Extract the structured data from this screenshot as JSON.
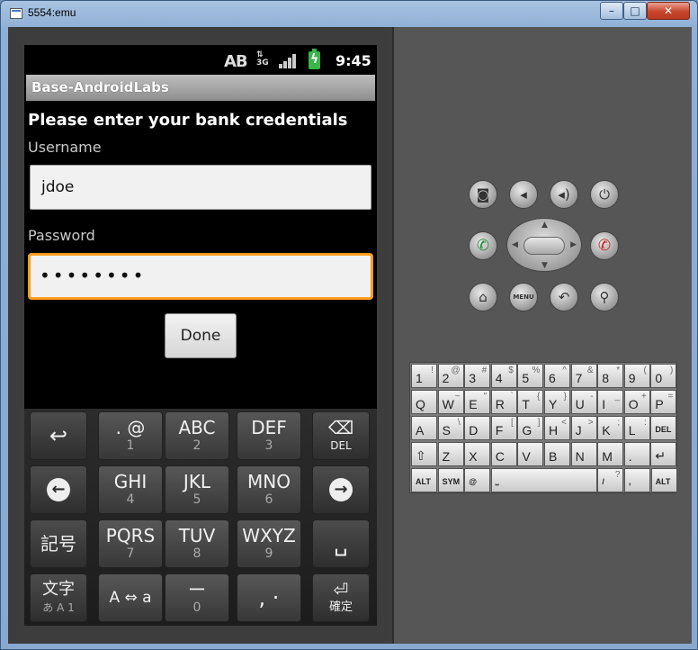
{
  "window": {
    "title": "5554:emu",
    "buttons": {
      "minimize": "–",
      "maximize": "□",
      "close": "✕"
    }
  },
  "statusbar": {
    "input_indicator": "AB",
    "network": "3G",
    "time": "9:45"
  },
  "app": {
    "title": "Base-AndroidLabs",
    "heading": "Please enter your bank credentials",
    "username_label": "Username",
    "username_value": "jdoe",
    "password_label": "Password",
    "password_value": "••••••••",
    "done_label": "Done"
  },
  "soft_keyboard": {
    "row1": [
      {
        "main": "↩",
        "sub": "",
        "icon": "undo-icon"
      },
      {
        "main": ". @",
        "sub": "1"
      },
      {
        "main": "ABC",
        "sub": "2"
      },
      {
        "main": "DEF",
        "sub": "3"
      },
      {
        "main": "⌫",
        "sub": "DEL",
        "icon": "backspace-icon"
      }
    ],
    "row2": [
      {
        "main": "←",
        "icon": "left-arrow-icon"
      },
      {
        "main": "GHI",
        "sub": "4"
      },
      {
        "main": "JKL",
        "sub": "5"
      },
      {
        "main": "MNO",
        "sub": "6"
      },
      {
        "main": "→",
        "icon": "right-arrow-icon"
      }
    ],
    "row3": [
      {
        "main": "記号",
        "sub": ""
      },
      {
        "main": "PQRS",
        "sub": "7"
      },
      {
        "main": "TUV",
        "sub": "8"
      },
      {
        "main": "WXYZ",
        "sub": "9"
      },
      {
        "main": "␣",
        "icon": "space-icon"
      }
    ],
    "row4": [
      {
        "main": "文字",
        "sub": "あ A 1"
      },
      {
        "main": "A ⇔ a",
        "sub": ""
      },
      {
        "main": "ー",
        "sub": "0"
      },
      {
        "main": ", ·",
        "sub": ""
      },
      {
        "main": "⏎",
        "sub": "確定",
        "icon": "enter-icon"
      }
    ]
  },
  "controls": {
    "row1": [
      "camera-icon",
      "volume-down-icon",
      "volume-up-icon",
      "power-icon"
    ],
    "call": "✆",
    "end": "✆",
    "row3": {
      "home": "⌂",
      "menu": "MENU",
      "back": "↶",
      "search": "⚲"
    }
  },
  "hardware_keyboard": {
    "row1": [
      [
        "1",
        "!"
      ],
      [
        "2",
        "@"
      ],
      [
        "3",
        "#"
      ],
      [
        "4",
        "$"
      ],
      [
        "5",
        "%"
      ],
      [
        "6",
        "^"
      ],
      [
        "7",
        "&"
      ],
      [
        "8",
        "*"
      ],
      [
        "9",
        "("
      ],
      [
        "0",
        ")"
      ]
    ],
    "row2": [
      [
        "Q",
        ""
      ],
      [
        "W",
        "~"
      ],
      [
        "E",
        "\""
      ],
      [
        "R",
        "`"
      ],
      [
        "T",
        "{"
      ],
      [
        "Y",
        "}"
      ],
      [
        "U",
        "-"
      ],
      [
        "I",
        "_"
      ],
      [
        "O",
        "+"
      ],
      [
        "P",
        "="
      ]
    ],
    "row3": [
      [
        "A",
        ""
      ],
      [
        "S",
        "\\"
      ],
      [
        "D",
        ""
      ],
      [
        "F",
        "["
      ],
      [
        "G",
        "]"
      ],
      [
        "H",
        "<"
      ],
      [
        "J",
        ">"
      ],
      [
        "K",
        ";"
      ],
      [
        "L",
        ":"
      ],
      [
        "DEL",
        ""
      ]
    ],
    "row4": [
      [
        "⇧",
        ""
      ],
      [
        "Z",
        ""
      ],
      [
        "X",
        ""
      ],
      [
        "C",
        ""
      ],
      [
        "V",
        ""
      ],
      [
        "B",
        ""
      ],
      [
        "N",
        ""
      ],
      [
        "M",
        ""
      ],
      [
        ".",
        ""
      ],
      [
        "↵",
        ""
      ]
    ],
    "row5": [
      [
        "ALT",
        ""
      ],
      [
        "SYM",
        ""
      ],
      [
        "@",
        ""
      ],
      [
        "⎵",
        ""
      ],
      [
        "/",
        "?"
      ],
      [
        ",",
        ""
      ],
      [
        "ALT",
        ""
      ]
    ]
  }
}
